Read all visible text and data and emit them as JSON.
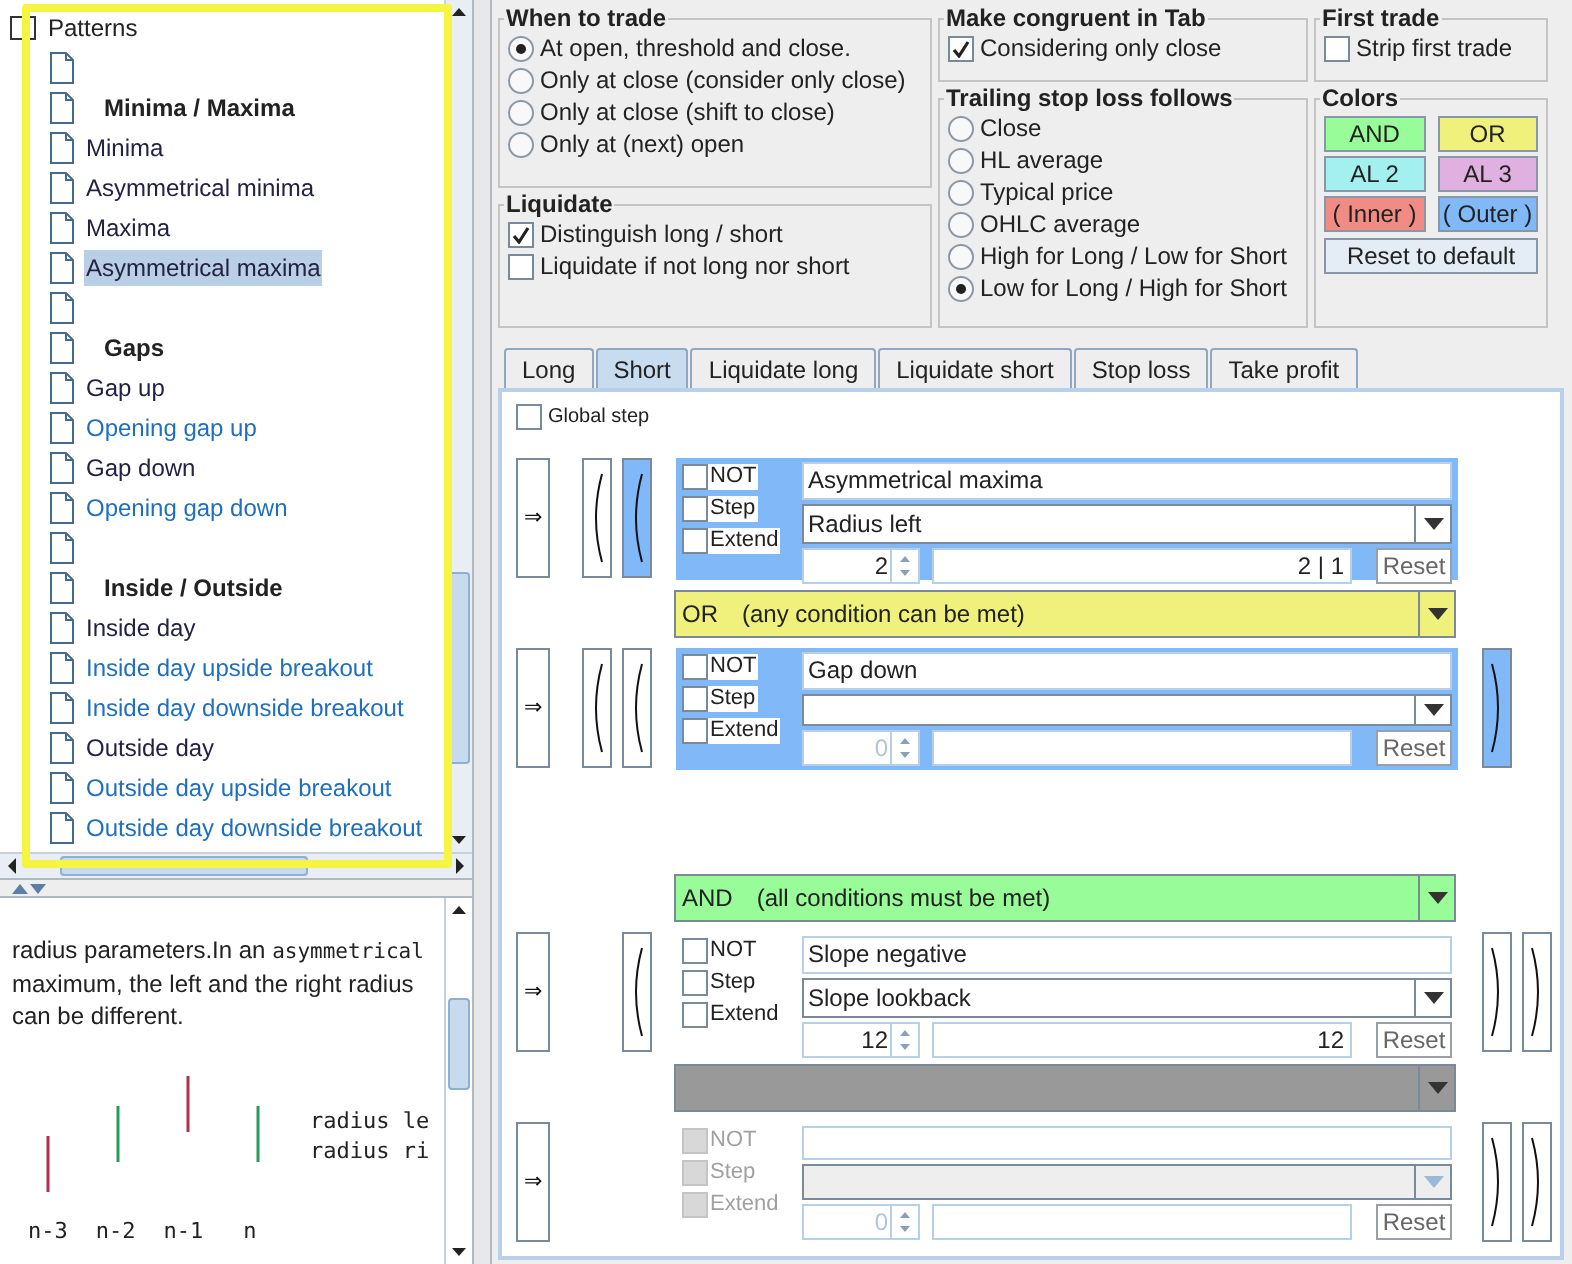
{
  "tree": {
    "items": [
      {
        "kind": "root",
        "label": "Patterns"
      },
      {
        "kind": "blank"
      },
      {
        "kind": "heading",
        "label": "Minima / Maxima"
      },
      {
        "kind": "item",
        "label": "Minima",
        "color": "#222244",
        "selected": false
      },
      {
        "kind": "item",
        "label": "Asymmetrical minima",
        "color": "#222244",
        "selected": false
      },
      {
        "kind": "item",
        "label": "Maxima",
        "color": "#222244",
        "selected": false
      },
      {
        "kind": "item",
        "label": "Asymmetrical maxima",
        "color": "#222244",
        "selected": true
      },
      {
        "kind": "blank"
      },
      {
        "kind": "heading",
        "label": "Gaps"
      },
      {
        "kind": "item",
        "label": "Gap up",
        "color": "#222244",
        "selected": false
      },
      {
        "kind": "item",
        "label": "Opening gap up",
        "color": "#1f6fbf",
        "selected": false
      },
      {
        "kind": "item",
        "label": "Gap down",
        "color": "#222244",
        "selected": false
      },
      {
        "kind": "item",
        "label": "Opening gap down",
        "color": "#1f6fbf",
        "selected": false
      },
      {
        "kind": "blank"
      },
      {
        "kind": "heading",
        "label": "Inside / Outside"
      },
      {
        "kind": "item",
        "label": "Inside day",
        "color": "#222244",
        "selected": false
      },
      {
        "kind": "item",
        "label": "Inside day upside breakout",
        "color": "#1f6fbf",
        "selected": false
      },
      {
        "kind": "item",
        "label": "Inside day downside breakout",
        "color": "#1f6fbf",
        "selected": false
      },
      {
        "kind": "item",
        "label": "Outside day",
        "color": "#222244",
        "selected": false
      },
      {
        "kind": "item",
        "label": "Outside day upside breakout",
        "color": "#1f6fbf",
        "selected": false
      },
      {
        "kind": "item",
        "label": "Outside day downside breakout",
        "color": "#1f6fbf",
        "selected": false
      }
    ]
  },
  "help": {
    "paragraph": [
      {
        "text": "radius parameters.In an ",
        "code": false
      },
      {
        "text": "asymmetrical",
        "code": true
      },
      {
        "text": " maximum, the left and the right radius can be different.",
        "code": false
      }
    ],
    "legend": [
      "radius le",
      "radius ri"
    ],
    "axis": [
      "n-3",
      "n-2",
      "n-1",
      "n"
    ]
  },
  "when_to_trade": {
    "title": "When to trade",
    "options": [
      {
        "label": "At open, threshold and close.",
        "selected": true
      },
      {
        "label": "Only at close (consider only close)",
        "selected": false
      },
      {
        "label": "Only at close (shift to close)",
        "selected": false
      },
      {
        "label": "Only at (next) open",
        "selected": false
      }
    ]
  },
  "liquidate": {
    "title": "Liquidate",
    "options": [
      {
        "label": "Distinguish long / short",
        "checked": true
      },
      {
        "label": "Liquidate if not long nor short",
        "checked": false
      }
    ]
  },
  "make_congruent": {
    "title": "Make congruent in Tab",
    "option": {
      "label": "Considering only close",
      "checked": true
    }
  },
  "trailing_stop": {
    "title": "Trailing stop loss follows",
    "options": [
      {
        "label": "Close",
        "selected": false
      },
      {
        "label": "HL average",
        "selected": false
      },
      {
        "label": "Typical price",
        "selected": false
      },
      {
        "label": "OHLC average",
        "selected": false
      },
      {
        "label": "High for Long / Low for Short",
        "selected": false
      },
      {
        "label": "Low for Long / High for Short",
        "selected": true
      }
    ]
  },
  "first_trade": {
    "title": "First trade",
    "option": {
      "label": "Strip first trade",
      "checked": false
    }
  },
  "colors": {
    "title": "Colors",
    "swatches": [
      {
        "label": "AND",
        "color": "#98fc98"
      },
      {
        "label": "OR",
        "color": "#f0f07c"
      },
      {
        "label": "AL 2",
        "color": "#a4f0f0"
      },
      {
        "label": "AL 3",
        "color": "#e0b0e0"
      },
      {
        "label": "( Inner )",
        "color": "#f08c84"
      },
      {
        "label": "( Outer )",
        "color": "#80b8f8"
      }
    ],
    "reset": "Reset to default"
  },
  "tabs": [
    {
      "label": "Long",
      "selected": false
    },
    {
      "label": "Short",
      "selected": true
    },
    {
      "label": "Liquidate long",
      "selected": false
    },
    {
      "label": "Liquidate short",
      "selected": false
    },
    {
      "label": "Stop loss",
      "selected": false
    },
    {
      "label": "Take profit",
      "selected": false
    }
  ],
  "global_step": {
    "label": "Global step",
    "checked": false
  },
  "condition_groups": [
    [
      {
        "kind": "condition",
        "arrow": "⇒",
        "left_parens": [
          {
            "selected": false
          },
          {
            "selected": true
          }
        ],
        "selected": true,
        "disabled": false,
        "flags": [
          {
            "label": "NOT",
            "checked": false
          },
          {
            "label": "Step",
            "checked": false
          },
          {
            "label": "Extend",
            "checked": false
          }
        ],
        "name": "Asymmetrical maxima",
        "parameter": "Radius left",
        "spinner": "2",
        "spinner_disabled": false,
        "value": "2 | 1",
        "reset": "Reset"
      },
      {
        "kind": "operator",
        "label": "OR",
        "description": "(any condition can be met)",
        "color": "#f0f07c"
      },
      {
        "kind": "condition",
        "arrow": "⇒",
        "left_parens": [
          {
            "selected": false
          },
          {
            "selected": false
          }
        ],
        "right_parens": [
          {
            "selected": true
          }
        ],
        "selected": true,
        "disabled": false,
        "flags": [
          {
            "label": "NOT",
            "checked": false
          },
          {
            "label": "Step",
            "checked": false
          },
          {
            "label": "Extend",
            "checked": false
          }
        ],
        "name": "Gap down",
        "spinner": "0",
        "spinner_disabled": true,
        "reset": "Reset"
      }
    ],
    [
      {
        "kind": "operator",
        "label": "AND",
        "description": "(all conditions must be met)",
        "color": "#98fc98"
      },
      {
        "kind": "condition",
        "arrow": "⇒",
        "left_parens": [
          {
            "selected": false
          }
        ],
        "right_parens": [
          {
            "selected": false
          },
          {
            "selected": false
          }
        ],
        "selected": false,
        "disabled": false,
        "flags": [
          {
            "label": "NOT",
            "checked": false
          },
          {
            "label": "Step",
            "checked": false
          },
          {
            "label": "Extend",
            "checked": false
          }
        ],
        "name": "Slope negative",
        "parameter": "Slope lookback",
        "spinner": "12",
        "spinner_disabled": false,
        "value": "12",
        "reset": "Reset"
      },
      {
        "kind": "operator",
        "color": "#999999"
      },
      {
        "kind": "condition",
        "arrow": "⇒",
        "right_parens": [
          {
            "selected": false
          },
          {
            "selected": false
          }
        ],
        "selected": false,
        "disabled": true,
        "flags": [
          {
            "label": "NOT",
            "checked": false
          },
          {
            "label": "Step",
            "checked": false
          },
          {
            "label": "Extend",
            "checked": false
          }
        ],
        "spinner": "0",
        "spinner_disabled": true,
        "reset": "Reset"
      }
    ]
  ]
}
